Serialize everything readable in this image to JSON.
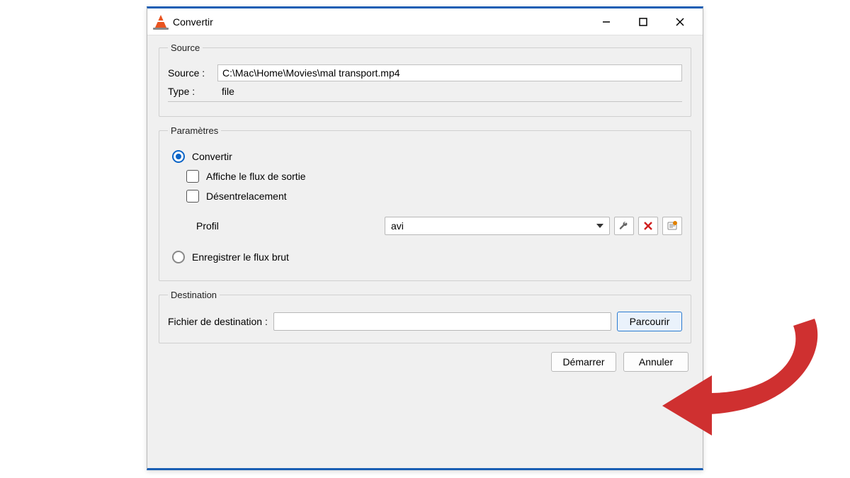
{
  "window": {
    "title": "Convertir"
  },
  "source": {
    "legend": "Source",
    "source_label": "Source :",
    "source_value": "C:\\Mac\\Home\\Movies\\mal transport.mp4",
    "type_label": "Type :",
    "type_value": "file"
  },
  "params": {
    "legend": "Paramètres",
    "convert_label": "Convertir",
    "show_output_label": "Affiche le flux de sortie",
    "deinterlace_label": "Désentrelacement",
    "profile_label": "Profil",
    "profile_value": "avi",
    "raw_label": "Enregistrer le flux brut"
  },
  "destination": {
    "legend": "Destination",
    "file_label": "Fichier de destination :",
    "browse_label": "Parcourir"
  },
  "footer": {
    "start_label": "Démarrer",
    "cancel_label": "Annuler"
  }
}
